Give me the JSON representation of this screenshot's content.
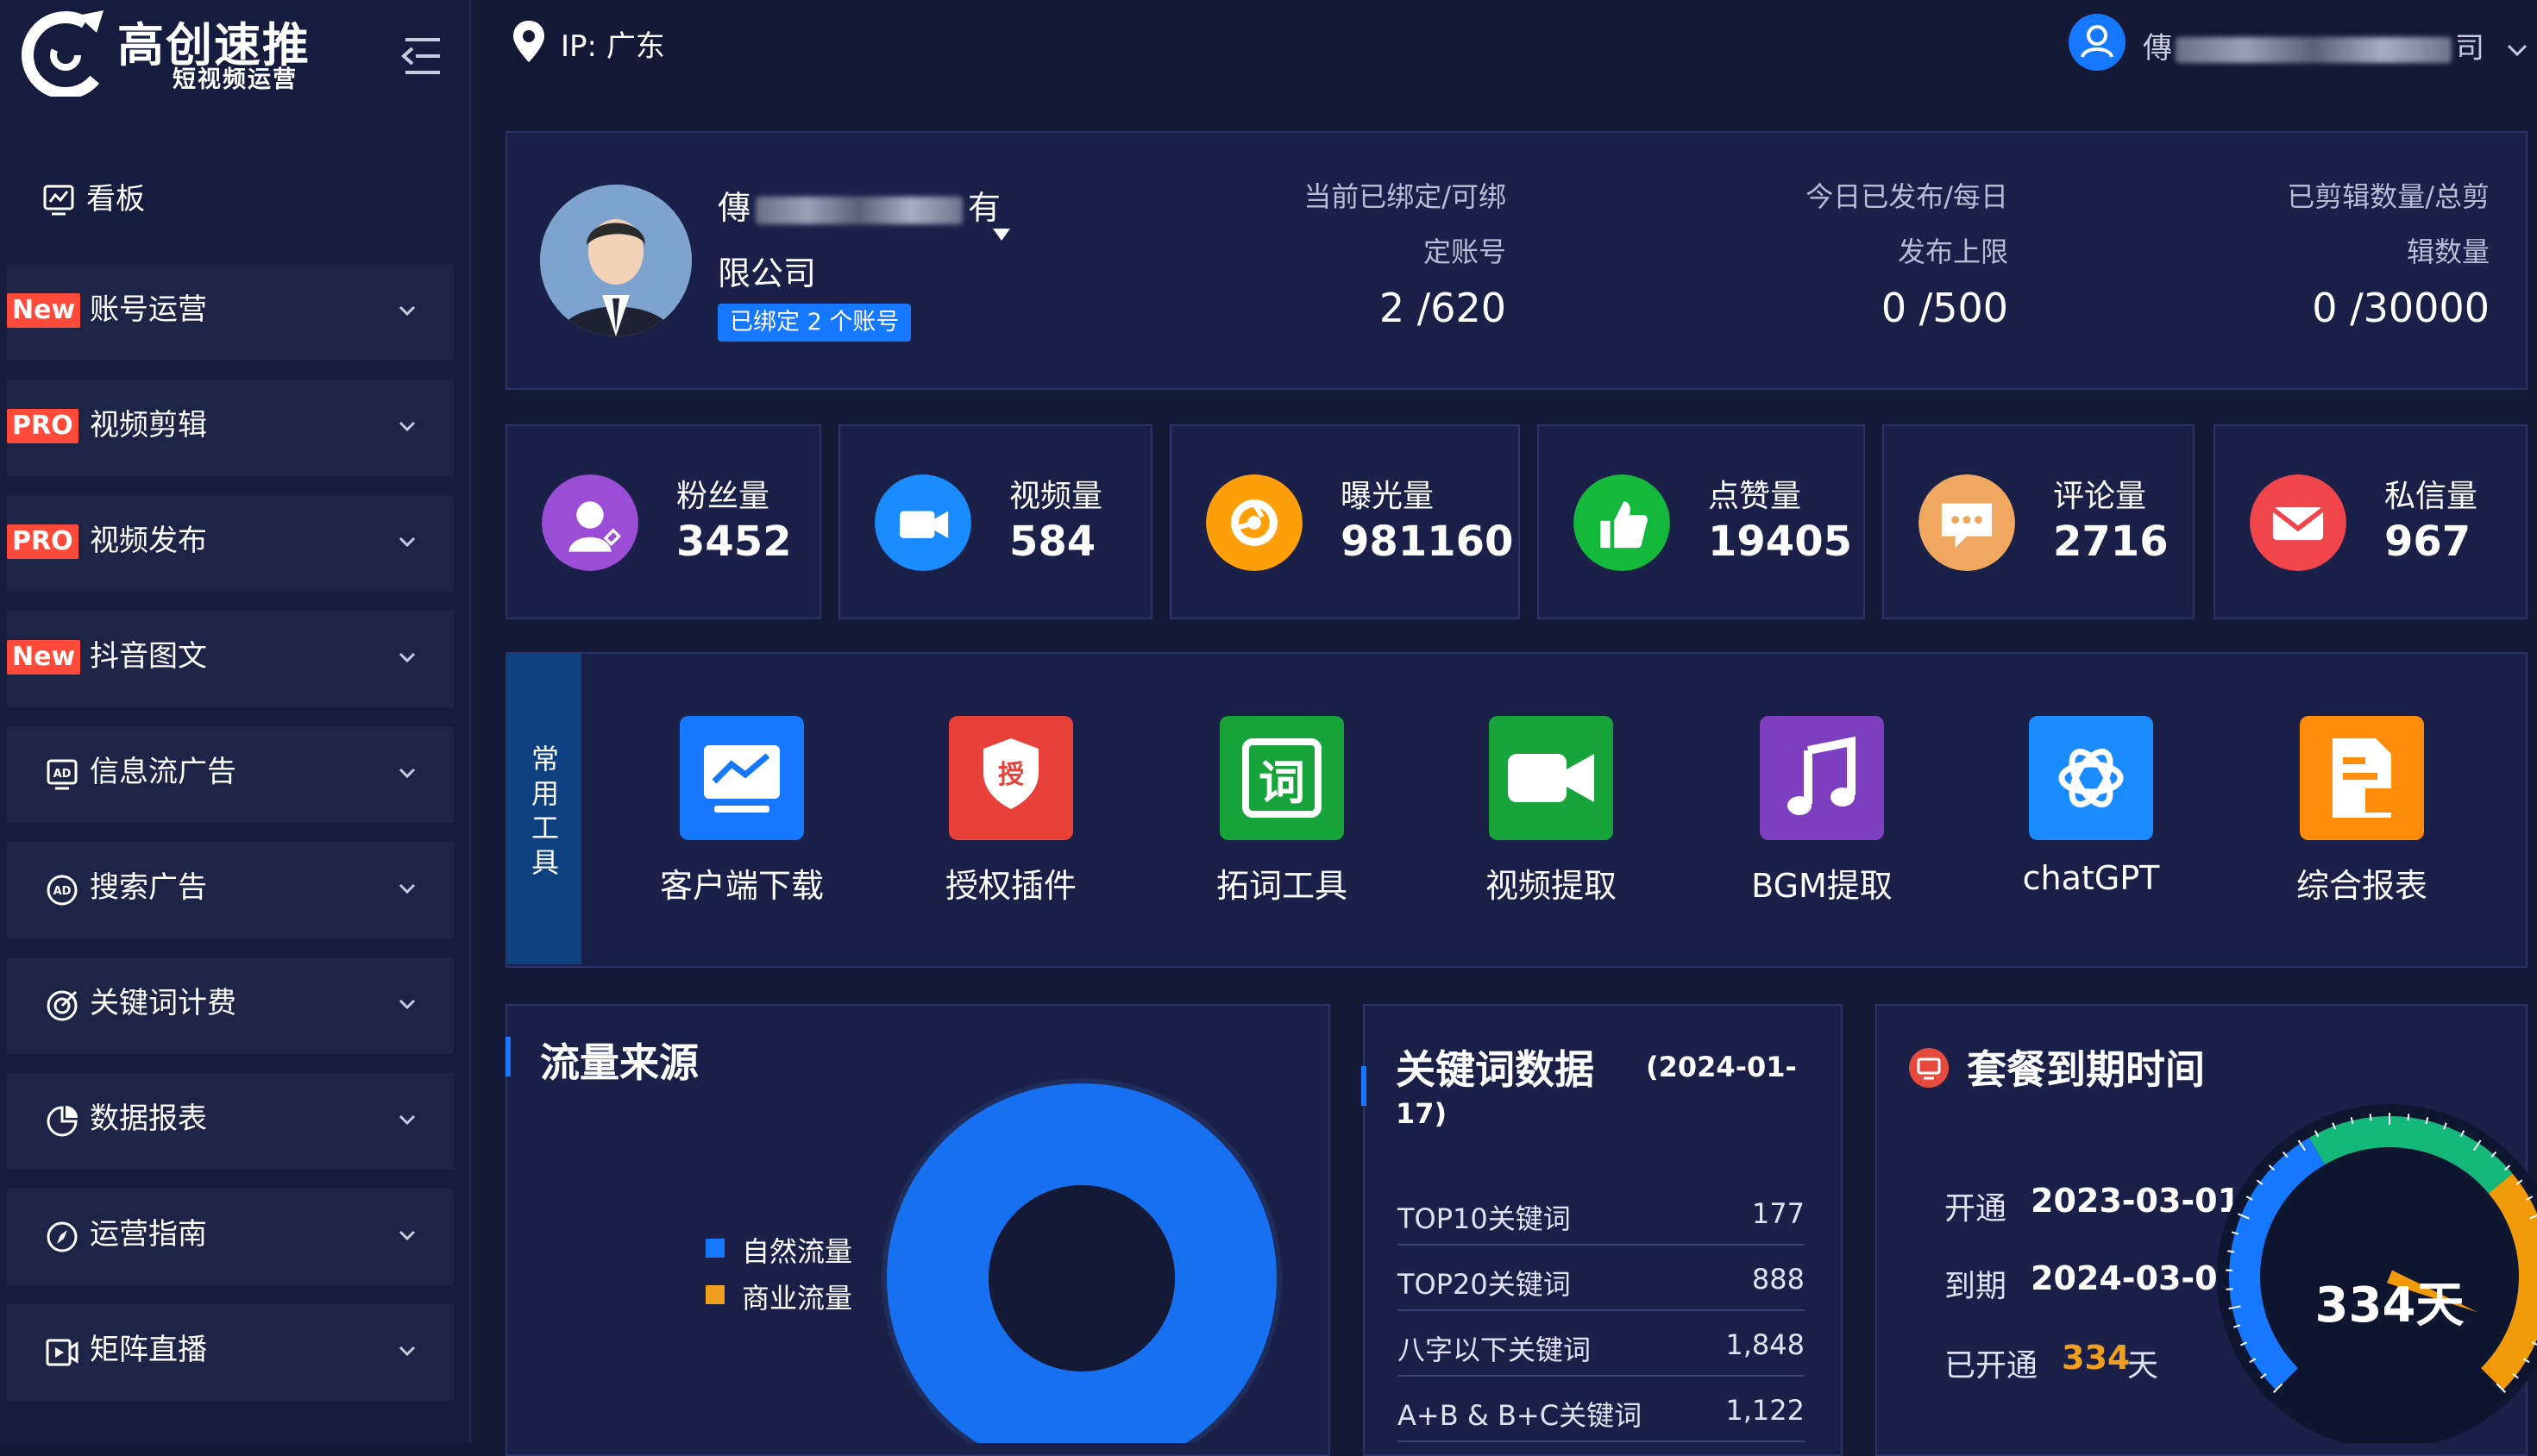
{
  "brand": {
    "title": "高创速推",
    "subtitle": "短视频运营"
  },
  "topbar": {
    "ip_label": "IP:",
    "ip_location": "广东",
    "user_name_start": "傳",
    "user_name_end": "司"
  },
  "sidebar": {
    "dashboard": {
      "label": "看板",
      "icon": "dashboard-icon"
    },
    "items": [
      {
        "label": "账号运营",
        "badge": "New",
        "icon": "chart-line-icon"
      },
      {
        "label": "视频剪辑",
        "badge": "PRO",
        "icon": "scissors-icon"
      },
      {
        "label": "视频发布",
        "badge": "PRO",
        "icon": "video-publish-icon"
      },
      {
        "label": "抖音图文",
        "badge": "New",
        "icon": "edit-image-icon"
      },
      {
        "label": "信息流广告",
        "badge": "",
        "icon": "ad-icon"
      },
      {
        "label": "搜索广告",
        "badge": "",
        "icon": "search-ad-icon"
      },
      {
        "label": "关键词计费",
        "badge": "",
        "icon": "target-icon"
      },
      {
        "label": "数据报表",
        "badge": "",
        "icon": "pie-chart-icon"
      },
      {
        "label": "运营指南",
        "badge": "",
        "icon": "compass-icon"
      },
      {
        "label": "矩阵直播",
        "badge": "",
        "icon": "live-icon"
      }
    ]
  },
  "profile": {
    "name_start": "傳",
    "name_end": "有",
    "name_line2": "限公司",
    "bound_tag": "已绑定 2 个账号",
    "stats": [
      {
        "label_line1": "当前已绑定/可绑",
        "label_line2": "定账号",
        "value": "2 /620"
      },
      {
        "label_line1": "今日已发布/每日",
        "label_line2": "发布上限",
        "value": "0 /500"
      },
      {
        "label_line1": "已剪辑数量/总剪",
        "label_line2": "辑数量",
        "value": "0 /30000"
      }
    ]
  },
  "metrics": [
    {
      "label": "粉丝量",
      "value": "3452",
      "icon": "fans-icon",
      "color": "#9b4dd6"
    },
    {
      "label": "视频量",
      "value": "584",
      "icon": "video-camera-icon",
      "color": "#1a8cff"
    },
    {
      "label": "曝光量",
      "value": "981160",
      "icon": "aperture-icon",
      "color": "#ff9f0a"
    },
    {
      "label": "点赞量",
      "value": "19405",
      "icon": "thumb-up-icon",
      "color": "#14b83a"
    },
    {
      "label": "评论量",
      "value": "2716",
      "icon": "comment-icon",
      "color": "#f0a860"
    },
    {
      "label": "私信量",
      "value": "967",
      "icon": "mail-icon",
      "color": "#f0454a"
    }
  ],
  "tools": {
    "section_label": [
      "常",
      "用",
      "工",
      "具"
    ],
    "items": [
      {
        "label": "客户端下载",
        "icon": "monitor-chart-icon",
        "color": "#1677ff"
      },
      {
        "label": "授权插件",
        "icon": "authorize-shield-icon",
        "color": "#e8413a",
        "icon_text": "授"
      },
      {
        "label": "拓词工具",
        "icon": "word-tool-icon",
        "color": "#17a43a",
        "icon_text": "词"
      },
      {
        "label": "视频提取",
        "icon": "video-extract-icon",
        "color": "#17a43a"
      },
      {
        "label": "BGM提取",
        "icon": "music-note-icon",
        "color": "#7d3fc0"
      },
      {
        "label": "chatGPT",
        "icon": "chatgpt-icon",
        "color": "#1a8cff"
      },
      {
        "label": "综合报表",
        "icon": "report-icon",
        "color": "#ff8c0a"
      }
    ]
  },
  "traffic": {
    "title": "流量来源",
    "legend": [
      {
        "name": "自然流量",
        "color": "#1677ff"
      },
      {
        "name": "商业流量",
        "color": "#f0a020"
      }
    ],
    "donut": {
      "natural_fraction": 1.0
    }
  },
  "keywords": {
    "title": "关键词数据",
    "date_line1": "(2024-01-",
    "date_line2": "17)",
    "rows": [
      {
        "name": "TOP10关键词",
        "value": "177"
      },
      {
        "name": "TOP20关键词",
        "value": "888"
      },
      {
        "name": "八字以下关键词",
        "value": "1,848"
      },
      {
        "name": "A+B & B+C关键词",
        "value": "1,122"
      }
    ]
  },
  "plan": {
    "title": "套餐到期时间",
    "open_label": "开通",
    "open_date": "2023-03-01",
    "expire_label": "到期",
    "expire_date": "2024-03-01",
    "opened_label": "已开通",
    "opened_days": "334",
    "days_unit": "天",
    "gauge_text": "334天",
    "gauge_fraction": 0.915
  }
}
